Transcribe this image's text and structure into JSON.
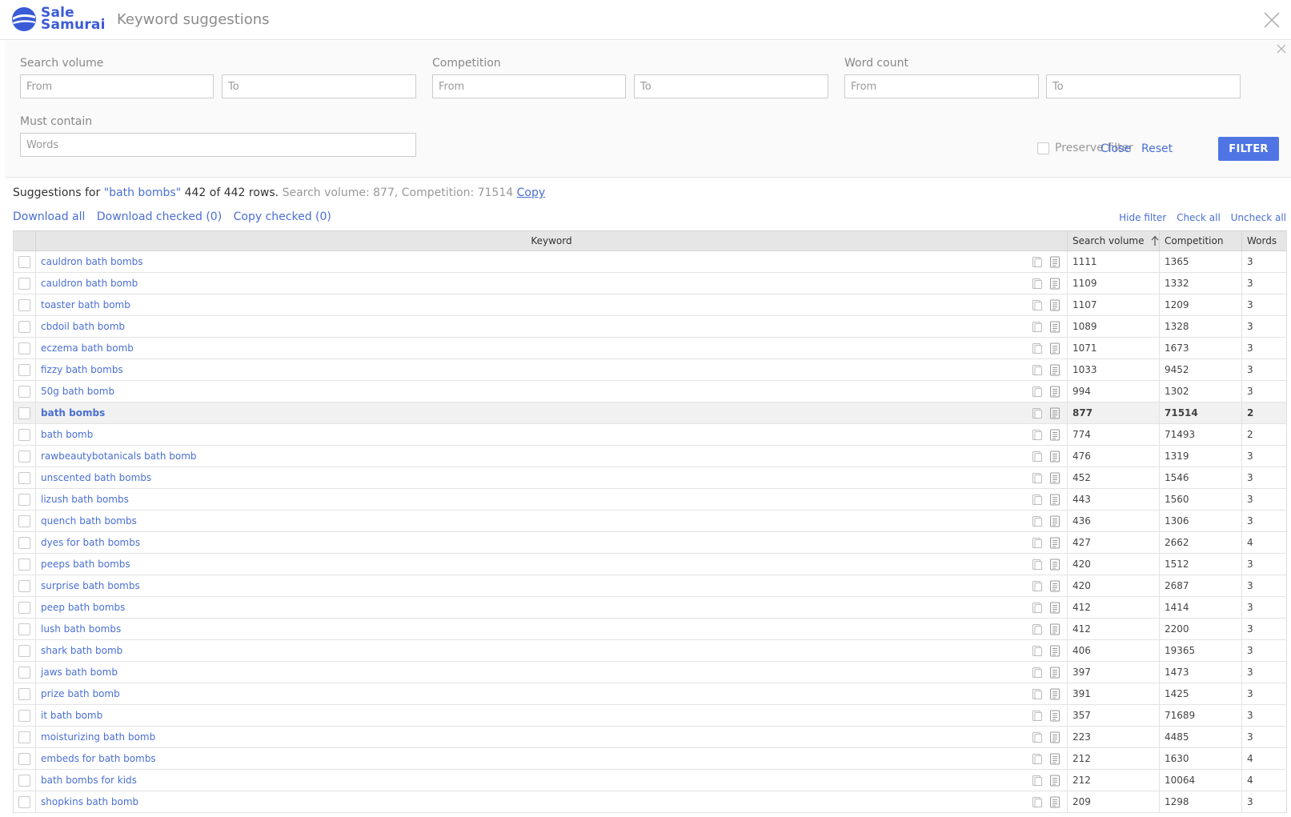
{
  "header": {
    "brand_line1": "Sale",
    "brand_line2": "Samurai",
    "title": "Keyword suggestions"
  },
  "filters": {
    "search_volume": {
      "label": "Search volume",
      "from_placeholder": "From",
      "to_placeholder": "To"
    },
    "competition": {
      "label": "Competition",
      "from_placeholder": "From",
      "to_placeholder": "To"
    },
    "word_count": {
      "label": "Word count",
      "from_placeholder": "From",
      "to_placeholder": "To"
    },
    "must_contain": {
      "label": "Must contain",
      "placeholder": "Words"
    },
    "preserve_label": "Preserve filter",
    "close_label": "Close",
    "reset_label": "Reset",
    "filter_label": "FILTER"
  },
  "summary": {
    "prefix": "Suggestions for",
    "query": "\"bath bombs\"",
    "rows": "442 of 442 rows.",
    "stats": "Search volume: 877, Competition: 71514",
    "copy_label": "Copy"
  },
  "actions": {
    "download_all": "Download all",
    "download_checked": "Download checked (0)",
    "copy_checked": "Copy checked (0)",
    "hide_filter": "Hide filter",
    "check_all": "Check all",
    "uncheck_all": "Uncheck all"
  },
  "table": {
    "headers": {
      "keyword": "Keyword",
      "search_volume": "Search volume",
      "competition": "Competition",
      "words": "Words"
    },
    "sort": {
      "column": "search_volume",
      "icon": "arrow-up-icon"
    },
    "highlighted_row": 7,
    "rows": [
      {
        "keyword": "cauldron bath bombs",
        "volume": "1111",
        "competition": "1365",
        "words": "3"
      },
      {
        "keyword": "cauldron bath bomb",
        "volume": "1109",
        "competition": "1332",
        "words": "3"
      },
      {
        "keyword": "toaster bath bomb",
        "volume": "1107",
        "competition": "1209",
        "words": "3"
      },
      {
        "keyword": "cbdoil bath bomb",
        "volume": "1089",
        "competition": "1328",
        "words": "3"
      },
      {
        "keyword": "eczema bath bomb",
        "volume": "1071",
        "competition": "1673",
        "words": "3"
      },
      {
        "keyword": "fizzy bath bombs",
        "volume": "1033",
        "competition": "9452",
        "words": "3"
      },
      {
        "keyword": "50g bath bomb",
        "volume": "994",
        "competition": "1302",
        "words": "3"
      },
      {
        "keyword": "bath bombs",
        "volume": "877",
        "competition": "71514",
        "words": "2"
      },
      {
        "keyword": "bath bomb",
        "volume": "774",
        "competition": "71493",
        "words": "2"
      },
      {
        "keyword": "rawbeautybotanicals bath bomb",
        "volume": "476",
        "competition": "1319",
        "words": "3"
      },
      {
        "keyword": "unscented bath bombs",
        "volume": "452",
        "competition": "1546",
        "words": "3"
      },
      {
        "keyword": "lizush bath bombs",
        "volume": "443",
        "competition": "1560",
        "words": "3"
      },
      {
        "keyword": "quench bath bombs",
        "volume": "436",
        "competition": "1306",
        "words": "3"
      },
      {
        "keyword": "dyes for bath bombs",
        "volume": "427",
        "competition": "2662",
        "words": "4"
      },
      {
        "keyword": "peeps bath bombs",
        "volume": "420",
        "competition": "1512",
        "words": "3"
      },
      {
        "keyword": "surprise bath bombs",
        "volume": "420",
        "competition": "2687",
        "words": "3"
      },
      {
        "keyword": "peep bath bombs",
        "volume": "412",
        "competition": "1414",
        "words": "3"
      },
      {
        "keyword": "lush bath bombs",
        "volume": "412",
        "competition": "2200",
        "words": "3"
      },
      {
        "keyword": "shark bath bomb",
        "volume": "406",
        "competition": "19365",
        "words": "3"
      },
      {
        "keyword": "jaws bath bomb",
        "volume": "397",
        "competition": "1473",
        "words": "3"
      },
      {
        "keyword": "prize bath bomb",
        "volume": "391",
        "competition": "1425",
        "words": "3"
      },
      {
        "keyword": "it bath bomb",
        "volume": "357",
        "competition": "71689",
        "words": "3"
      },
      {
        "keyword": "moisturizing bath bomb",
        "volume": "223",
        "competition": "4485",
        "words": "3"
      },
      {
        "keyword": "embeds for bath bombs",
        "volume": "212",
        "competition": "1630",
        "words": "4"
      },
      {
        "keyword": "bath bombs for kids",
        "volume": "212",
        "competition": "10064",
        "words": "4"
      },
      {
        "keyword": "shopkins bath bomb",
        "volume": "209",
        "competition": "1298",
        "words": "3"
      }
    ]
  },
  "colors": {
    "accent": "#4f75e5",
    "link": "#4a6fd4",
    "brand": "#3a5bd6"
  }
}
